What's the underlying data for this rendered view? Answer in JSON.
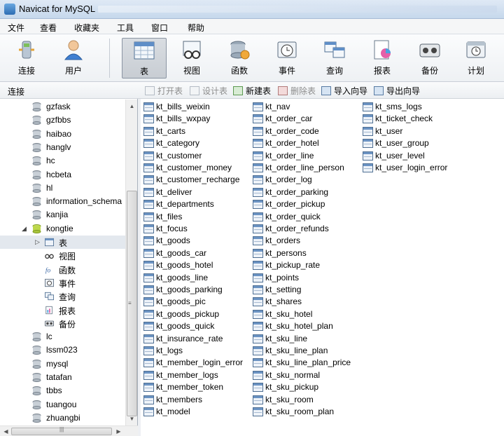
{
  "window": {
    "title": "Navicat for MySQL"
  },
  "menu": [
    "文件",
    "查看",
    "收藏夹",
    "工具",
    "窗口",
    "帮助"
  ],
  "toolbar": [
    {
      "label": "连接",
      "icon": "connection-icon"
    },
    {
      "label": "用户",
      "icon": "user-icon"
    },
    {
      "label": "表",
      "icon": "table-icon",
      "active": true
    },
    {
      "label": "视图",
      "icon": "view-icon"
    },
    {
      "label": "函数",
      "icon": "function-icon"
    },
    {
      "label": "事件",
      "icon": "event-icon"
    },
    {
      "label": "查询",
      "icon": "query-icon"
    },
    {
      "label": "报表",
      "icon": "report-icon"
    },
    {
      "label": "备份",
      "icon": "backup-icon"
    },
    {
      "label": "计划",
      "icon": "schedule-icon"
    }
  ],
  "connection_label": "连接",
  "actions": [
    {
      "label": "打开表",
      "enabled": false,
      "icon": "open-table-icon"
    },
    {
      "label": "设计表",
      "enabled": false,
      "icon": "design-table-icon"
    },
    {
      "label": "新建表",
      "enabled": true,
      "icon": "new-table-icon"
    },
    {
      "label": "删除表",
      "enabled": false,
      "icon": "delete-table-icon"
    },
    {
      "label": "导入向导",
      "enabled": true,
      "icon": "import-wizard-icon"
    },
    {
      "label": "导出向导",
      "enabled": true,
      "icon": "export-wizard-icon"
    }
  ],
  "databases_before": [
    "gzfask",
    "gzfbbs",
    "haibao",
    "hanglv",
    "hc",
    "hcbeta",
    "hl",
    "information_schema",
    "kanjia"
  ],
  "open_database": "kongtie",
  "open_database_children": [
    {
      "label": "表",
      "icon": "table-icon",
      "selected": true
    },
    {
      "label": "视图",
      "icon": "view-icon"
    },
    {
      "label": "函数",
      "icon": "function-icon"
    },
    {
      "label": "事件",
      "icon": "event-icon"
    },
    {
      "label": "查询",
      "icon": "query-icon"
    },
    {
      "label": "报表",
      "icon": "report-icon"
    },
    {
      "label": "备份",
      "icon": "backup-icon"
    }
  ],
  "databases_after": [
    "lc",
    "lssm023",
    "mysql",
    "tatafan",
    "tbbs",
    "tuangou",
    "zhuangbi"
  ],
  "tables": [
    [
      "kt_bills_weixin",
      "kt_bills_wxpay",
      "kt_carts",
      "kt_category",
      "kt_customer",
      "kt_customer_money",
      "kt_customer_recharge",
      "kt_deliver",
      "kt_departments",
      "kt_files",
      "kt_focus",
      "kt_goods",
      "kt_goods_car",
      "kt_goods_hotel",
      "kt_goods_line",
      "kt_goods_parking",
      "kt_goods_pic",
      "kt_goods_pickup",
      "kt_goods_quick",
      "kt_insurance_rate",
      "kt_logs",
      "kt_member_login_error",
      "kt_member_logs",
      "kt_member_token",
      "kt_members",
      "kt_model"
    ],
    [
      "kt_nav",
      "kt_order_car",
      "kt_order_code",
      "kt_order_hotel",
      "kt_order_line",
      "kt_order_line_person",
      "kt_order_log",
      "kt_order_parking",
      "kt_order_pickup",
      "kt_order_quick",
      "kt_order_refunds",
      "kt_orders",
      "kt_persons",
      "kt_pickup_rate",
      "kt_points",
      "kt_setting",
      "kt_shares",
      "kt_sku_hotel",
      "kt_sku_hotel_plan",
      "kt_sku_line",
      "kt_sku_line_plan",
      "kt_sku_line_plan_price",
      "kt_sku_normal",
      "kt_sku_pickup",
      "kt_sku_room",
      "kt_sku_room_plan"
    ],
    [
      "kt_sms_logs",
      "kt_ticket_check",
      "kt_user",
      "kt_user_group",
      "kt_user_level",
      "kt_user_login_error"
    ]
  ]
}
